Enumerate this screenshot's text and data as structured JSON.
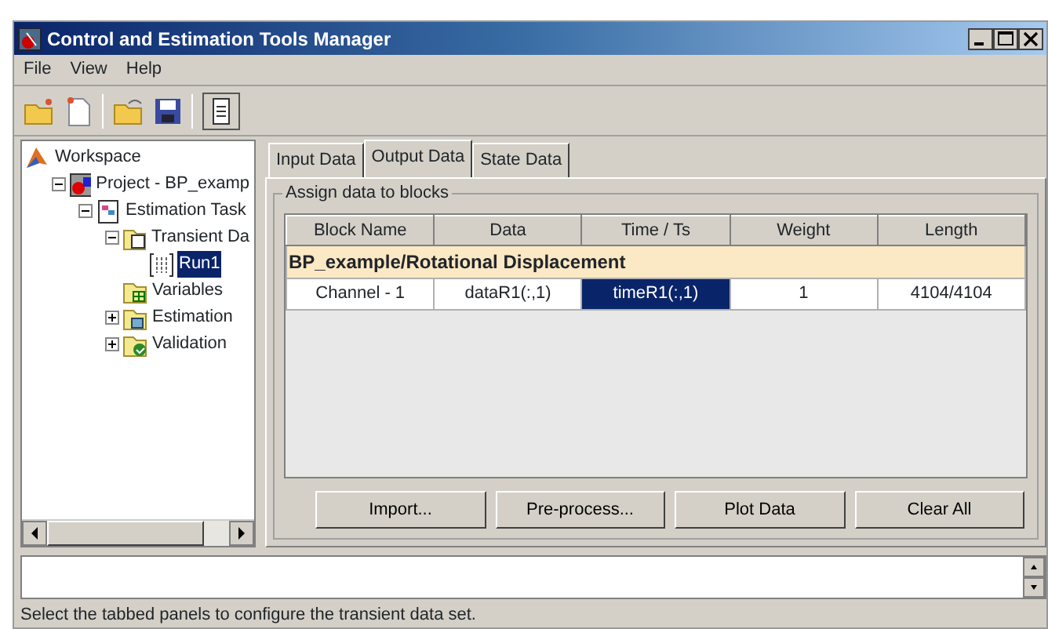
{
  "window": {
    "title": "Control and Estimation Tools Manager"
  },
  "menu": [
    "File",
    "View",
    "Help"
  ],
  "tree": [
    {
      "label": "Workspace",
      "kind": "workspace",
      "selected": false,
      "children": [
        {
          "label": "Project - BP_examp",
          "kind": "project",
          "expanded": true,
          "selected": false,
          "children": [
            {
              "label": "Estimation Task",
              "kind": "task",
              "expanded": true,
              "selected": false,
              "children": [
                {
                  "label": "Transient Da",
                  "kind": "data",
                  "expanded": true,
                  "selected": false,
                  "children": [
                    {
                      "label": "Run1",
                      "kind": "run",
                      "selected": true
                    }
                  ]
                },
                {
                  "label": "Variables",
                  "kind": "variables",
                  "selected": false
                },
                {
                  "label": "Estimation",
                  "kind": "estimation",
                  "expanded": false,
                  "selected": false
                },
                {
                  "label": "Validation",
                  "kind": "validation",
                  "expanded": false,
                  "selected": false
                }
              ]
            }
          ]
        }
      ]
    }
  ],
  "tabs": [
    {
      "label": "Input Data",
      "selected": false
    },
    {
      "label": "Output Data",
      "selected": true
    },
    {
      "label": "State Data",
      "selected": false
    }
  ],
  "group_title": "Assign data to blocks",
  "table": {
    "columns": [
      "Block Name",
      "Data",
      "Time / Ts",
      "Weight",
      "Length"
    ],
    "group_row": "BP_example/Rotational Displacement",
    "rows": [
      {
        "cells": [
          {
            "text": "Channel - 1",
            "selected": false
          },
          {
            "text": "dataR1(:,1)",
            "selected": false
          },
          {
            "text": "timeR1(:,1)",
            "selected": true
          },
          {
            "text": "1",
            "selected": false
          },
          {
            "text": "4104/4104",
            "selected": false
          }
        ]
      }
    ]
  },
  "buttons": [
    "Import...",
    "Pre-process...",
    "Plot Data",
    "Clear All"
  ],
  "status_bar": "Select the tabbed panels to configure the transient data set."
}
